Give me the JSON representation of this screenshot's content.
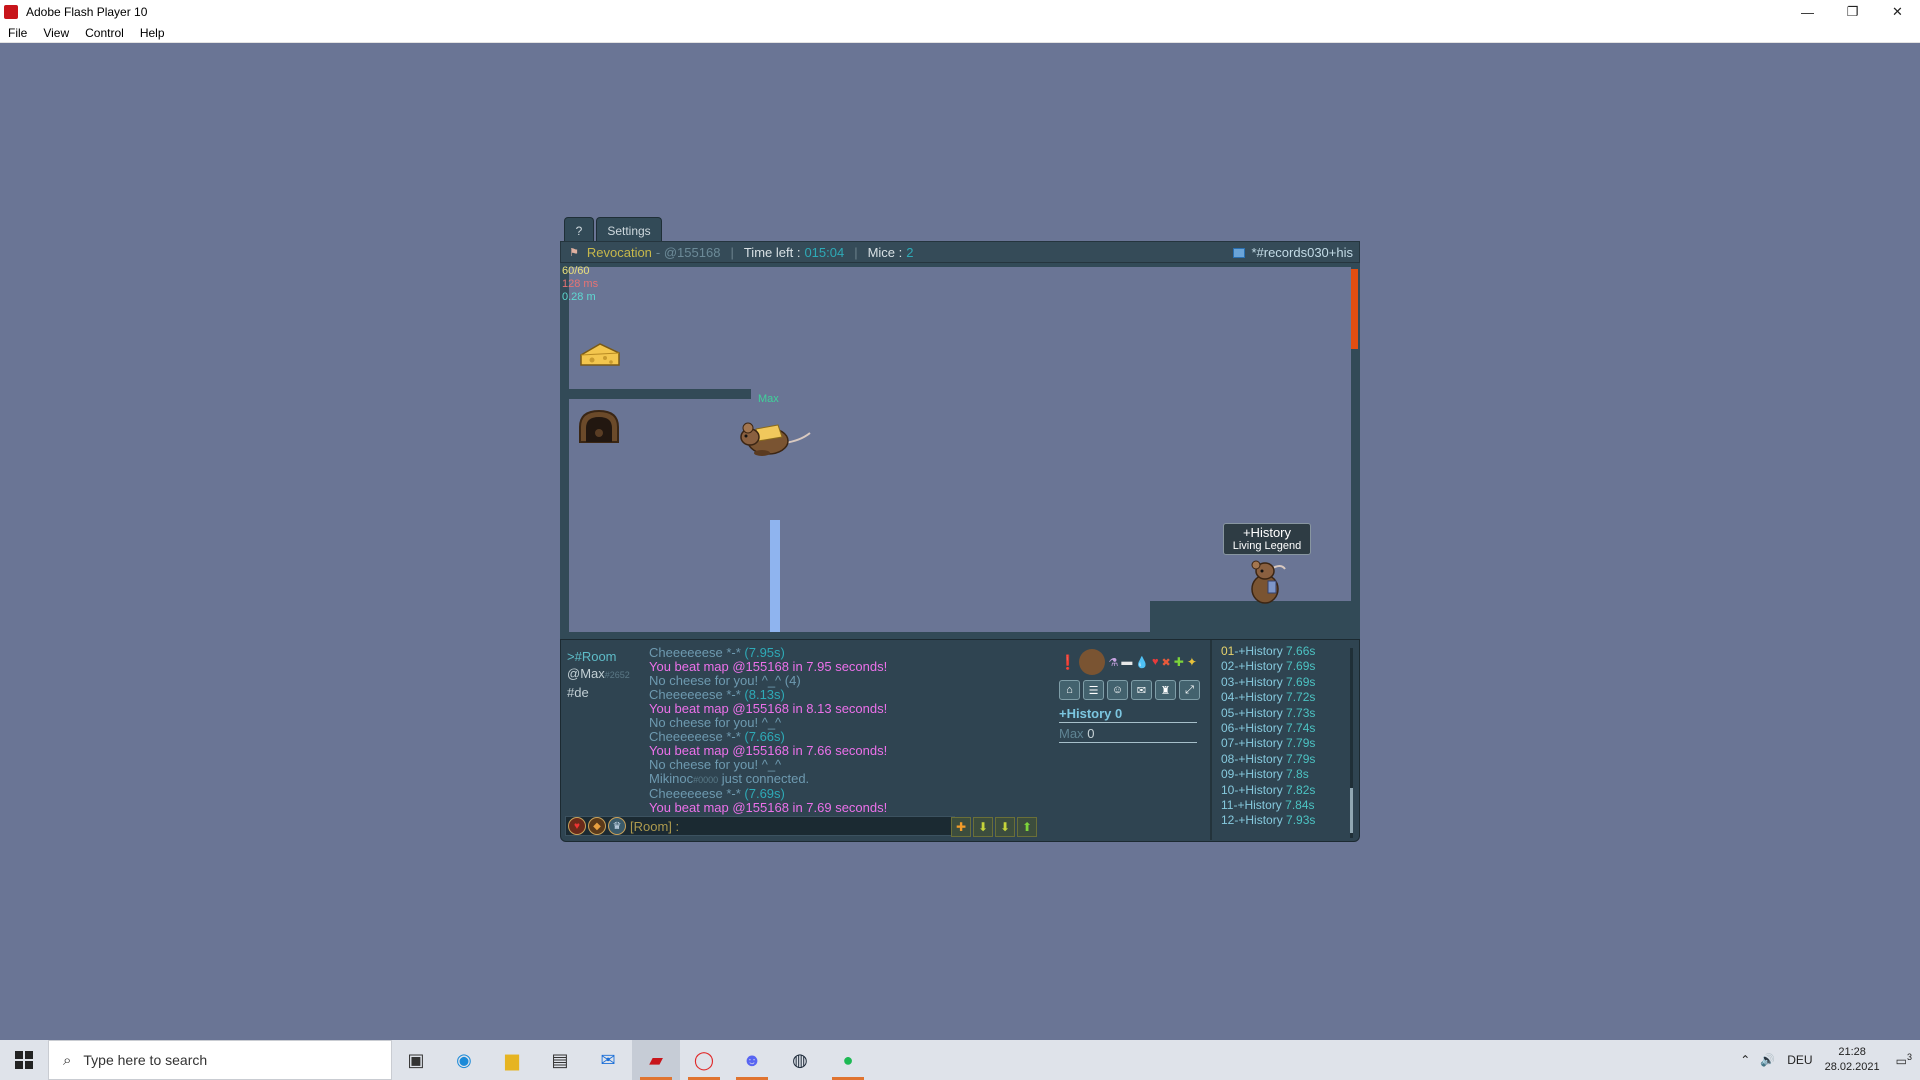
{
  "window": {
    "title": "Adobe Flash Player 10",
    "minimize_glyph": "—",
    "restore_glyph": "❐",
    "close_glyph": "✕",
    "menu": [
      "File",
      "View",
      "Control",
      "Help"
    ]
  },
  "game": {
    "tabs": {
      "help_label": "?",
      "settings_label": "Settings"
    },
    "topbar": {
      "map_name": "Revocation",
      "map_code": "- @155168",
      "time_label": "Time left :",
      "time_value": "015:04",
      "mice_label": "Mice :",
      "mice_value": "2",
      "room_name": "*#records030+his"
    },
    "stats": {
      "fps": "60/60",
      "ping": "128 ms",
      "distance": "0.28 m"
    },
    "players": {
      "max_label": "Max",
      "history_title": "+History",
      "history_subtitle": "Living Legend"
    },
    "channels": {
      "room": ">#Room",
      "whisper_name": "@Max",
      "whisper_tag": "#2652",
      "lang": "#de"
    },
    "chat": [
      {
        "text": "Cheeeeeese *-* ",
        "extra": "(7.95s)",
        "style": "gray"
      },
      {
        "text": "You beat map @155168 in 7.95 seconds!",
        "style": "pink"
      },
      {
        "text": "No cheese for you! ^_^ (4)",
        "style": "gray"
      },
      {
        "text": "Cheeeeeese *-* ",
        "extra": "(8.13s)",
        "style": "gray"
      },
      {
        "text": "You beat map @155168 in 8.13 seconds!",
        "style": "pink"
      },
      {
        "text": "No cheese for you! ^_^",
        "style": "gray"
      },
      {
        "text": "Cheeeeeese *-* ",
        "extra": "(7.66s)",
        "style": "gray"
      },
      {
        "text": "You beat map @155168 in 7.66 seconds!",
        "style": "pink"
      },
      {
        "text": "No cheese for you! ^_^",
        "style": "gray"
      },
      {
        "text": "Mikinoc",
        "small": "#0000",
        "tail": " just connected.",
        "style": "gray"
      },
      {
        "text": "Cheeeeeese *-* ",
        "extra": "(7.69s)",
        "style": "gray"
      },
      {
        "text": "You beat map @155168 in 7.69 seconds!",
        "style": "pink"
      }
    ],
    "input": {
      "label": "[Room] :",
      "value": ""
    },
    "scoreboard": {
      "player1_name": "+History",
      "player1_score": "0",
      "player2_name": "Max",
      "player2_score": "0"
    },
    "ranks": [
      {
        "pos": "01",
        "name": "-+History",
        "time": "7.66s"
      },
      {
        "pos": "02",
        "name": "-+History",
        "time": "7.69s"
      },
      {
        "pos": "03",
        "name": "-+History",
        "time": "7.69s"
      },
      {
        "pos": "04",
        "name": "-+History",
        "time": "7.72s"
      },
      {
        "pos": "05",
        "name": "-+History",
        "time": "7.73s"
      },
      {
        "pos": "06",
        "name": "-+History",
        "time": "7.74s"
      },
      {
        "pos": "07",
        "name": "-+History",
        "time": "7.79s"
      },
      {
        "pos": "08",
        "name": "-+History",
        "time": "7.79s"
      },
      {
        "pos": "09",
        "name": "-+History",
        "time": "7.8s"
      },
      {
        "pos": "10",
        "name": "-+History",
        "time": "7.82s"
      },
      {
        "pos": "11",
        "name": "-+History",
        "time": "7.84s"
      },
      {
        "pos": "12",
        "name": "-+History",
        "time": "7.93s"
      }
    ]
  },
  "taskbar": {
    "search_placeholder": "Type here to search",
    "lang": "DEU",
    "time": "21:28",
    "date": "28.02.2021",
    "notifications": "3"
  }
}
